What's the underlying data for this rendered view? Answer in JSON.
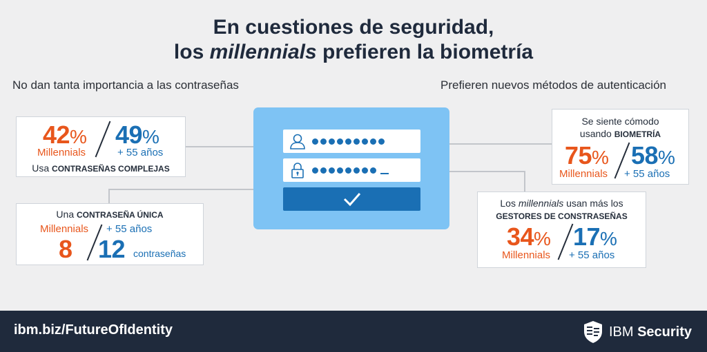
{
  "title": {
    "line1": "En cuestiones de seguridad,",
    "line2_pre": "los ",
    "line2_em": "millennials",
    "line2_post": " prefieren la biometría"
  },
  "left_heading": "No dan tanta importancia a las contraseñas",
  "right_heading": "Prefieren nuevos métodos de autenticación",
  "card_complex": {
    "m_value": "42",
    "o_value": "49",
    "pct": "%",
    "m_label": "Millennials",
    "o_label": "+ 55 años",
    "caption_pre": "Usa ",
    "caption_bold": "CONTRASEÑAS COMPLEJAS"
  },
  "card_single": {
    "caption_pre": "Una ",
    "caption_bold": "CONTRASEÑA ÚNICA",
    "m_label": "Millennials",
    "o_label": "+ 55 años",
    "m_value": "8",
    "o_value": "12",
    "unit": "contraseñas"
  },
  "card_bio": {
    "caption_l1": "Se siente cómodo",
    "caption_l2_pre": "usando ",
    "caption_l2_bold": "BIOMETRÍA",
    "m_value": "75",
    "o_value": "58",
    "pct": "%",
    "m_label": "Millennials",
    "o_label": "+ 55 años"
  },
  "card_managers": {
    "caption_pre": "Los ",
    "caption_em": "millennials",
    "caption_post": " usan más los",
    "caption_l2_bold": "GESTORES DE CONSTRASEÑAS",
    "m_value": "34",
    "o_value": "17",
    "pct": "%",
    "m_label": "Millennials",
    "o_label": "+ 55 años"
  },
  "login": {
    "user_icon": "user-icon",
    "lock_icon": "lock-icon",
    "user_dots": 9,
    "lock_dots": 8,
    "check_icon": "check-icon"
  },
  "footer": {
    "url": "ibm.biz/FutureOfIdentity",
    "brand_pre": "IBM ",
    "brand_bold": "Security",
    "logo_icon": "shield-logo-icon"
  },
  "colors": {
    "orange": "#e8561c",
    "blue": "#1a6fb4",
    "navy": "#1f2a3c",
    "panel": "#7ec3f4"
  }
}
